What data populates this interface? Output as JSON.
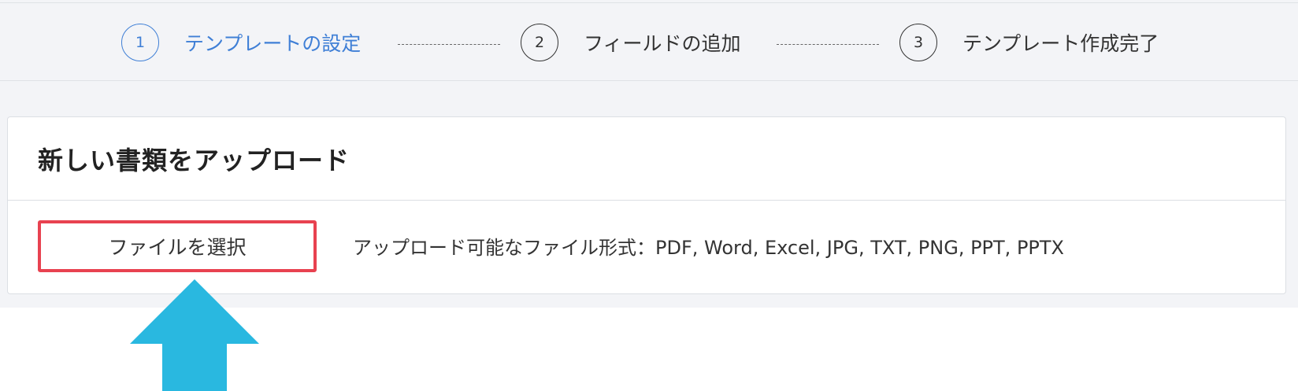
{
  "stepper": {
    "steps": [
      {
        "number": "1",
        "label": "テンプレートの設定"
      },
      {
        "number": "2",
        "label": "フィールドの追加"
      },
      {
        "number": "3",
        "label": "テンプレート作成完了"
      }
    ],
    "active_step": "1",
    "active_color": "#3f7fd6"
  },
  "upload_card": {
    "title": "新しい書類をアップロード",
    "select_file_label": "ファイルを選択",
    "formats_text": "アップロード可能なファイル形式：PDF, Word, Excel, JPG, TXT, PNG, PPT, PPTX"
  },
  "annotation": {
    "highlight_color": "#e84250",
    "arrow_color": "#29b8e0",
    "arrow_icon": "up-arrow-icon"
  }
}
